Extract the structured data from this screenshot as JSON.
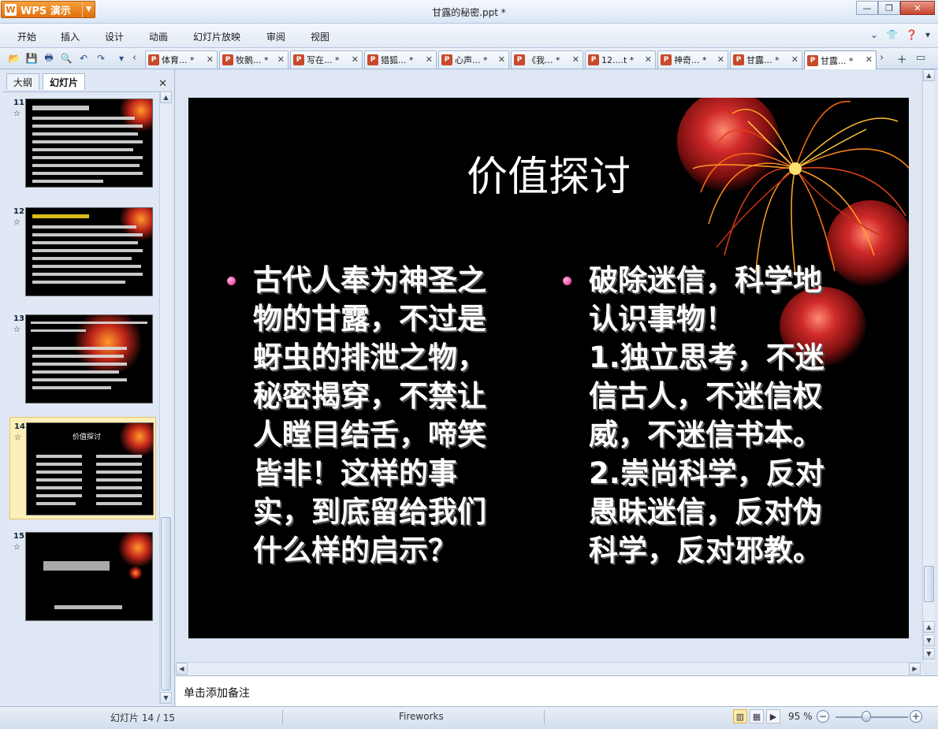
{
  "app": {
    "button_label": "WPS 演示",
    "window_title": "甘露的秘密.ppt *"
  },
  "menu": [
    "开始",
    "插入",
    "设计",
    "动画",
    "幻灯片放映",
    "审阅",
    "视图"
  ],
  "doc_tabs": [
    "体育... *",
    "牧鹅... *",
    "写在... *",
    "猎狐... *",
    "心声... *",
    "《我... *",
    "12....t *",
    "神奇... *",
    "甘露... *",
    "甘露... *"
  ],
  "panel": {
    "tabs": [
      "大纲",
      "幻灯片"
    ],
    "active_tab": "幻灯片",
    "thumbnails": [
      {
        "num": "11",
        "selected": false
      },
      {
        "num": "12",
        "selected": false
      },
      {
        "num": "13",
        "selected": false
      },
      {
        "num": "14",
        "selected": true,
        "title": "价值探讨"
      },
      {
        "num": "15",
        "selected": false
      }
    ]
  },
  "slide": {
    "title": "价值探讨",
    "left_text": "古代人奉为神圣之物的甘露，不过是蚜虫的排泄之物，秘密揭穿，不禁让人瞠目结舌，啼笑皆非！这样的事实，到底留给我们什么样的启示？",
    "right_intro": "破除迷信，科学地认识事物！",
    "right_point1_num": "1.",
    "right_point1": "独立思考，不迷信古人，不迷信权威，不迷信书本。",
    "right_point2_num": "2.",
    "right_point2": "崇尚科学，反对愚昧迷信，反对伪科学，反对邪教。"
  },
  "notes": {
    "placeholder": "单击添加备注"
  },
  "status": {
    "slide_counter": "幻灯片 14 / 15",
    "theme": "Fireworks",
    "zoom": "95 %"
  },
  "icons": [
    "open-icon",
    "save-icon",
    "print-icon",
    "print-preview-icon",
    "undo-icon",
    "redo-icon",
    "ppt-file-icon",
    "close-icon",
    "help-icon",
    "skin-icon"
  ]
}
